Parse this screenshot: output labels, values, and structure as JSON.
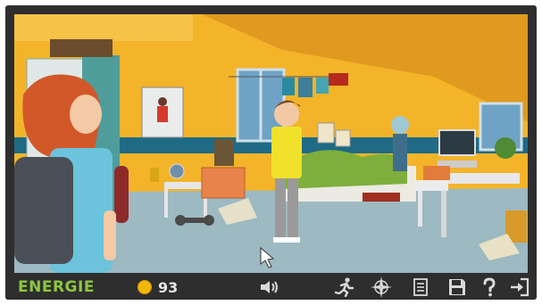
{
  "hud": {
    "energy_label": "ENERGIE",
    "coin_count": "93",
    "colors": {
      "energy_label": "#8cc63f",
      "coin": "#f2b705",
      "hud_background": "#2e2e2e",
      "icon": "#d9d9d9"
    },
    "icons": [
      "sound-icon",
      "run-icon",
      "compass-icon",
      "inventory-icon",
      "save-icon",
      "help-icon",
      "exit-icon"
    ]
  },
  "scene": {
    "description_icons": [
      "poster-icon",
      "trophy-icon",
      "globe-icon",
      "skateboard-icon",
      "dumbbell-icon",
      "computer-icon",
      "cursor-icon"
    ]
  }
}
